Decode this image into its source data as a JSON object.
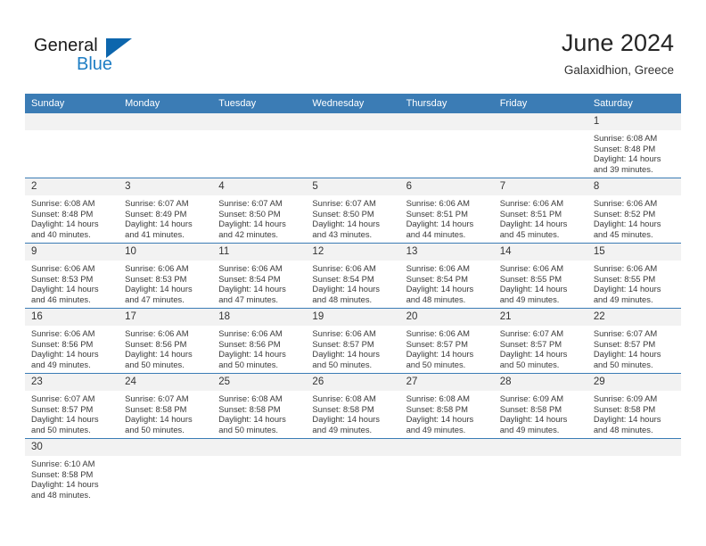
{
  "brand": {
    "name_part1": "General",
    "name_part2": "Blue",
    "logo_icon": "triangle-flag-icon"
  },
  "header": {
    "title": "June 2024",
    "subtitle": "Galaxidhion, Greece"
  },
  "calendar": {
    "accent_color": "#3b7cb5",
    "daynum_band_color": "#f2f2f2",
    "weekday_headers": [
      "Sunday",
      "Monday",
      "Tuesday",
      "Wednesday",
      "Thursday",
      "Friday",
      "Saturday"
    ],
    "weeks": [
      [
        {
          "day": "",
          "sunrise": "",
          "sunset": "",
          "daylight_line1": "",
          "daylight_line2": ""
        },
        {
          "day": "",
          "sunrise": "",
          "sunset": "",
          "daylight_line1": "",
          "daylight_line2": ""
        },
        {
          "day": "",
          "sunrise": "",
          "sunset": "",
          "daylight_line1": "",
          "daylight_line2": ""
        },
        {
          "day": "",
          "sunrise": "",
          "sunset": "",
          "daylight_line1": "",
          "daylight_line2": ""
        },
        {
          "day": "",
          "sunrise": "",
          "sunset": "",
          "daylight_line1": "",
          "daylight_line2": ""
        },
        {
          "day": "",
          "sunrise": "",
          "sunset": "",
          "daylight_line1": "",
          "daylight_line2": ""
        },
        {
          "day": "1",
          "sunrise": "Sunrise: 6:08 AM",
          "sunset": "Sunset: 8:48 PM",
          "daylight_line1": "Daylight: 14 hours",
          "daylight_line2": "and 39 minutes."
        }
      ],
      [
        {
          "day": "2",
          "sunrise": "Sunrise: 6:08 AM",
          "sunset": "Sunset: 8:48 PM",
          "daylight_line1": "Daylight: 14 hours",
          "daylight_line2": "and 40 minutes."
        },
        {
          "day": "3",
          "sunrise": "Sunrise: 6:07 AM",
          "sunset": "Sunset: 8:49 PM",
          "daylight_line1": "Daylight: 14 hours",
          "daylight_line2": "and 41 minutes."
        },
        {
          "day": "4",
          "sunrise": "Sunrise: 6:07 AM",
          "sunset": "Sunset: 8:50 PM",
          "daylight_line1": "Daylight: 14 hours",
          "daylight_line2": "and 42 minutes."
        },
        {
          "day": "5",
          "sunrise": "Sunrise: 6:07 AM",
          "sunset": "Sunset: 8:50 PM",
          "daylight_line1": "Daylight: 14 hours",
          "daylight_line2": "and 43 minutes."
        },
        {
          "day": "6",
          "sunrise": "Sunrise: 6:06 AM",
          "sunset": "Sunset: 8:51 PM",
          "daylight_line1": "Daylight: 14 hours",
          "daylight_line2": "and 44 minutes."
        },
        {
          "day": "7",
          "sunrise": "Sunrise: 6:06 AM",
          "sunset": "Sunset: 8:51 PM",
          "daylight_line1": "Daylight: 14 hours",
          "daylight_line2": "and 45 minutes."
        },
        {
          "day": "8",
          "sunrise": "Sunrise: 6:06 AM",
          "sunset": "Sunset: 8:52 PM",
          "daylight_line1": "Daylight: 14 hours",
          "daylight_line2": "and 45 minutes."
        }
      ],
      [
        {
          "day": "9",
          "sunrise": "Sunrise: 6:06 AM",
          "sunset": "Sunset: 8:53 PM",
          "daylight_line1": "Daylight: 14 hours",
          "daylight_line2": "and 46 minutes."
        },
        {
          "day": "10",
          "sunrise": "Sunrise: 6:06 AM",
          "sunset": "Sunset: 8:53 PM",
          "daylight_line1": "Daylight: 14 hours",
          "daylight_line2": "and 47 minutes."
        },
        {
          "day": "11",
          "sunrise": "Sunrise: 6:06 AM",
          "sunset": "Sunset: 8:54 PM",
          "daylight_line1": "Daylight: 14 hours",
          "daylight_line2": "and 47 minutes."
        },
        {
          "day": "12",
          "sunrise": "Sunrise: 6:06 AM",
          "sunset": "Sunset: 8:54 PM",
          "daylight_line1": "Daylight: 14 hours",
          "daylight_line2": "and 48 minutes."
        },
        {
          "day": "13",
          "sunrise": "Sunrise: 6:06 AM",
          "sunset": "Sunset: 8:54 PM",
          "daylight_line1": "Daylight: 14 hours",
          "daylight_line2": "and 48 minutes."
        },
        {
          "day": "14",
          "sunrise": "Sunrise: 6:06 AM",
          "sunset": "Sunset: 8:55 PM",
          "daylight_line1": "Daylight: 14 hours",
          "daylight_line2": "and 49 minutes."
        },
        {
          "day": "15",
          "sunrise": "Sunrise: 6:06 AM",
          "sunset": "Sunset: 8:55 PM",
          "daylight_line1": "Daylight: 14 hours",
          "daylight_line2": "and 49 minutes."
        }
      ],
      [
        {
          "day": "16",
          "sunrise": "Sunrise: 6:06 AM",
          "sunset": "Sunset: 8:56 PM",
          "daylight_line1": "Daylight: 14 hours",
          "daylight_line2": "and 49 minutes."
        },
        {
          "day": "17",
          "sunrise": "Sunrise: 6:06 AM",
          "sunset": "Sunset: 8:56 PM",
          "daylight_line1": "Daylight: 14 hours",
          "daylight_line2": "and 50 minutes."
        },
        {
          "day": "18",
          "sunrise": "Sunrise: 6:06 AM",
          "sunset": "Sunset: 8:56 PM",
          "daylight_line1": "Daylight: 14 hours",
          "daylight_line2": "and 50 minutes."
        },
        {
          "day": "19",
          "sunrise": "Sunrise: 6:06 AM",
          "sunset": "Sunset: 8:57 PM",
          "daylight_line1": "Daylight: 14 hours",
          "daylight_line2": "and 50 minutes."
        },
        {
          "day": "20",
          "sunrise": "Sunrise: 6:06 AM",
          "sunset": "Sunset: 8:57 PM",
          "daylight_line1": "Daylight: 14 hours",
          "daylight_line2": "and 50 minutes."
        },
        {
          "day": "21",
          "sunrise": "Sunrise: 6:07 AM",
          "sunset": "Sunset: 8:57 PM",
          "daylight_line1": "Daylight: 14 hours",
          "daylight_line2": "and 50 minutes."
        },
        {
          "day": "22",
          "sunrise": "Sunrise: 6:07 AM",
          "sunset": "Sunset: 8:57 PM",
          "daylight_line1": "Daylight: 14 hours",
          "daylight_line2": "and 50 minutes."
        }
      ],
      [
        {
          "day": "23",
          "sunrise": "Sunrise: 6:07 AM",
          "sunset": "Sunset: 8:57 PM",
          "daylight_line1": "Daylight: 14 hours",
          "daylight_line2": "and 50 minutes."
        },
        {
          "day": "24",
          "sunrise": "Sunrise: 6:07 AM",
          "sunset": "Sunset: 8:58 PM",
          "daylight_line1": "Daylight: 14 hours",
          "daylight_line2": "and 50 minutes."
        },
        {
          "day": "25",
          "sunrise": "Sunrise: 6:08 AM",
          "sunset": "Sunset: 8:58 PM",
          "daylight_line1": "Daylight: 14 hours",
          "daylight_line2": "and 50 minutes."
        },
        {
          "day": "26",
          "sunrise": "Sunrise: 6:08 AM",
          "sunset": "Sunset: 8:58 PM",
          "daylight_line1": "Daylight: 14 hours",
          "daylight_line2": "and 49 minutes."
        },
        {
          "day": "27",
          "sunrise": "Sunrise: 6:08 AM",
          "sunset": "Sunset: 8:58 PM",
          "daylight_line1": "Daylight: 14 hours",
          "daylight_line2": "and 49 minutes."
        },
        {
          "day": "28",
          "sunrise": "Sunrise: 6:09 AM",
          "sunset": "Sunset: 8:58 PM",
          "daylight_line1": "Daylight: 14 hours",
          "daylight_line2": "and 49 minutes."
        },
        {
          "day": "29",
          "sunrise": "Sunrise: 6:09 AM",
          "sunset": "Sunset: 8:58 PM",
          "daylight_line1": "Daylight: 14 hours",
          "daylight_line2": "and 48 minutes."
        }
      ],
      [
        {
          "day": "30",
          "sunrise": "Sunrise: 6:10 AM",
          "sunset": "Sunset: 8:58 PM",
          "daylight_line1": "Daylight: 14 hours",
          "daylight_line2": "and 48 minutes."
        },
        {
          "day": "",
          "sunrise": "",
          "sunset": "",
          "daylight_line1": "",
          "daylight_line2": ""
        },
        {
          "day": "",
          "sunrise": "",
          "sunset": "",
          "daylight_line1": "",
          "daylight_line2": ""
        },
        {
          "day": "",
          "sunrise": "",
          "sunset": "",
          "daylight_line1": "",
          "daylight_line2": ""
        },
        {
          "day": "",
          "sunrise": "",
          "sunset": "",
          "daylight_line1": "",
          "daylight_line2": ""
        },
        {
          "day": "",
          "sunrise": "",
          "sunset": "",
          "daylight_line1": "",
          "daylight_line2": ""
        },
        {
          "day": "",
          "sunrise": "",
          "sunset": "",
          "daylight_line1": "",
          "daylight_line2": ""
        }
      ]
    ]
  }
}
